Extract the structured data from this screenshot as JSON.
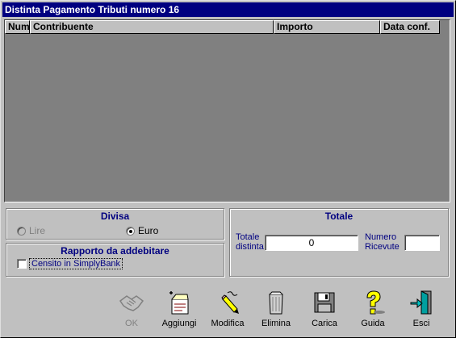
{
  "window": {
    "title": "Distinta Pagamento Tributi numero 16"
  },
  "grid": {
    "columns": [
      "Num",
      "Contribuente",
      "Importo",
      "Data conf."
    ]
  },
  "divisa": {
    "title": "Divisa",
    "options": [
      {
        "label": "Lire",
        "selected": false,
        "enabled": false
      },
      {
        "label": "Euro",
        "selected": true,
        "enabled": true
      }
    ]
  },
  "rapporto": {
    "title": "Rapporto da addebitare",
    "checkbox_label": "Censito in SimplyBank",
    "checked": false
  },
  "totale": {
    "title": "Totale",
    "distinta_label_1": "Totale",
    "distinta_label_2": "distinta",
    "distinta_value": "0",
    "ricevute_label_1": "Numero",
    "ricevute_label_2": "Ricevute",
    "ricevute_value": ""
  },
  "toolbar": {
    "ok": "OK",
    "aggiungi": "Aggiungi",
    "modifica": "Modifica",
    "elimina": "Elimina",
    "carica": "Carica",
    "guida": "Guida",
    "esci": "Esci"
  },
  "colors": {
    "title_bar": "#000080",
    "label_blue": "#000080",
    "grid_bg": "#808080",
    "face": "#c0c0c0"
  }
}
